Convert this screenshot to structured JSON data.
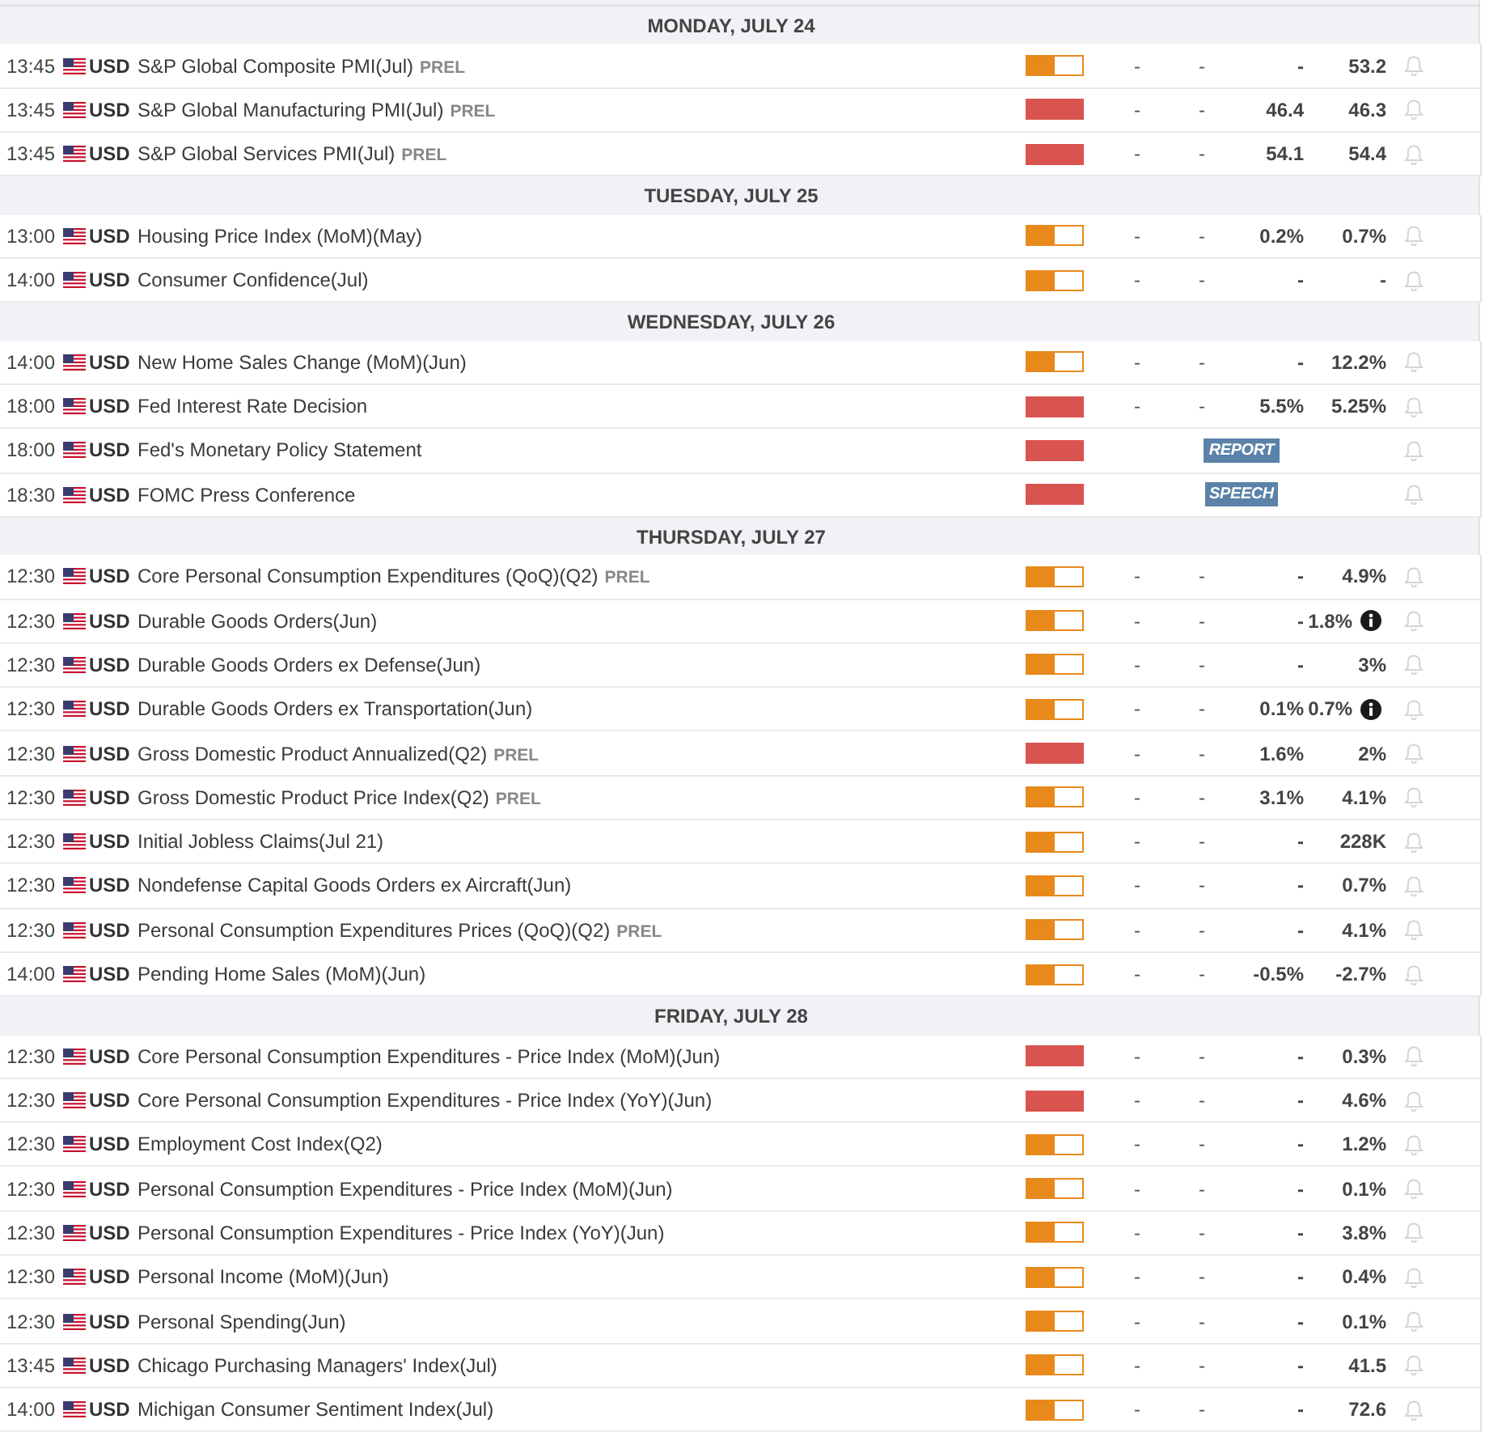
{
  "days": [
    {
      "label": "MONDAY, JULY 24",
      "events": [
        {
          "time": "13:45",
          "currency": "USD",
          "title": "S&P Global Composite PMI(Jul)",
          "note": "PREL",
          "level": 0.5,
          "values": [
            "-",
            "-",
            "-",
            "53.2"
          ],
          "info": false
        },
        {
          "time": "13:45",
          "currency": "USD",
          "title": "S&P Global Manufacturing PMI(Jul)",
          "note": "PREL",
          "level": 1,
          "values": [
            "-",
            "-",
            "46.4",
            "46.3"
          ],
          "info": false
        },
        {
          "time": "13:45",
          "currency": "USD",
          "title": "S&P Global Services PMI(Jul)",
          "note": "PREL",
          "level": 1,
          "values": [
            "-",
            "-",
            "54.1",
            "54.4"
          ],
          "info": false
        }
      ]
    },
    {
      "label": "TUESDAY, JULY 25",
      "events": [
        {
          "time": "13:00",
          "currency": "USD",
          "title": "Housing Price Index (MoM)(May)",
          "level": 0.5,
          "values": [
            "-",
            "-",
            "0.2%",
            "0.7%"
          ],
          "info": false
        },
        {
          "time": "14:00",
          "currency": "USD",
          "title": "Consumer Confidence(Jul)",
          "level": 0.5,
          "values": [
            "-",
            "-",
            "-",
            "-"
          ],
          "info": false
        }
      ]
    },
    {
      "label": "WEDNESDAY, JULY 26",
      "events": [
        {
          "time": "14:00",
          "currency": "USD",
          "title": "New Home Sales Change (MoM)(Jun)",
          "level": 0.5,
          "values": [
            "-",
            "-",
            "-",
            "12.2%"
          ],
          "info": false
        },
        {
          "time": "18:00",
          "currency": "USD",
          "title": "Fed Interest Rate Decision",
          "level": 1,
          "values": [
            "-",
            "-",
            "5.5%",
            "5.25%"
          ],
          "info": false
        },
        {
          "time": "18:00",
          "currency": "USD",
          "title": "Fed's Monetary Policy Statement",
          "level": 1,
          "tag": "REPORT",
          "info": false
        },
        {
          "time": "18:30",
          "currency": "USD",
          "title": "FOMC Press Conference",
          "level": 1,
          "tag": "SPEECH",
          "info": false
        }
      ]
    },
    {
      "label": "THURSDAY, JULY 27",
      "events": [
        {
          "time": "12:30",
          "currency": "USD",
          "title": "Core Personal Consumption Expenditures (QoQ)(Q2)",
          "note": "PREL",
          "level": 0.5,
          "values": [
            "-",
            "-",
            "-",
            "4.9%"
          ],
          "info": false
        },
        {
          "time": "12:30",
          "currency": "USD",
          "title": "Durable Goods Orders(Jun)",
          "level": 0.5,
          "values": [
            "-",
            "-",
            "-",
            "1.8%"
          ],
          "info": true
        },
        {
          "time": "12:30",
          "currency": "USD",
          "title": "Durable Goods Orders ex Defense(Jun)",
          "level": 0.5,
          "values": [
            "-",
            "-",
            "-",
            "3%"
          ],
          "info": false
        },
        {
          "time": "12:30",
          "currency": "USD",
          "title": "Durable Goods Orders ex Transportation(Jun)",
          "level": 0.5,
          "values": [
            "-",
            "-",
            "0.1%",
            "0.7%"
          ],
          "info": true
        },
        {
          "time": "12:30",
          "currency": "USD",
          "title": "Gross Domestic Product Annualized(Q2)",
          "note": "PREL",
          "level": 1,
          "values": [
            "-",
            "-",
            "1.6%",
            "2%"
          ],
          "info": false
        },
        {
          "time": "12:30",
          "currency": "USD",
          "title": "Gross Domestic Product Price Index(Q2)",
          "note": "PREL",
          "level": 0.5,
          "values": [
            "-",
            "-",
            "3.1%",
            "4.1%"
          ],
          "info": false
        },
        {
          "time": "12:30",
          "currency": "USD",
          "title": "Initial Jobless Claims(Jul 21)",
          "level": 0.5,
          "values": [
            "-",
            "-",
            "-",
            "228K"
          ],
          "info": false
        },
        {
          "time": "12:30",
          "currency": "USD",
          "title": "Nondefense Capital Goods Orders ex Aircraft(Jun)",
          "level": 0.5,
          "values": [
            "-",
            "-",
            "-",
            "0.7%"
          ],
          "info": false
        },
        {
          "time": "12:30",
          "currency": "USD",
          "title": "Personal Consumption Expenditures Prices (QoQ)(Q2)",
          "note": "PREL",
          "level": 0.5,
          "values": [
            "-",
            "-",
            "-",
            "4.1%"
          ],
          "info": false
        },
        {
          "time": "14:00",
          "currency": "USD",
          "title": "Pending Home Sales (MoM)(Jun)",
          "level": 0.5,
          "values": [
            "-",
            "-",
            "-0.5%",
            "-2.7%"
          ],
          "info": false
        }
      ]
    },
    {
      "label": "FRIDAY, JULY 28",
      "events": [
        {
          "time": "12:30",
          "currency": "USD",
          "title": "Core Personal Consumption Expenditures - Price Index (MoM)(Jun)",
          "level": 1,
          "values": [
            "-",
            "-",
            "-",
            "0.3%"
          ],
          "info": false
        },
        {
          "time": "12:30",
          "currency": "USD",
          "title": "Core Personal Consumption Expenditures - Price Index (YoY)(Jun)",
          "level": 1,
          "values": [
            "-",
            "-",
            "-",
            "4.6%"
          ],
          "info": false
        },
        {
          "time": "12:30",
          "currency": "USD",
          "title": "Employment Cost Index(Q2)",
          "level": 0.5,
          "values": [
            "-",
            "-",
            "-",
            "1.2%"
          ],
          "info": false
        },
        {
          "time": "12:30",
          "currency": "USD",
          "title": "Personal Consumption Expenditures - Price Index (MoM)(Jun)",
          "level": 0.5,
          "values": [
            "-",
            "-",
            "-",
            "0.1%"
          ],
          "info": false
        },
        {
          "time": "12:30",
          "currency": "USD",
          "title": "Personal Consumption Expenditures - Price Index (YoY)(Jun)",
          "level": 0.5,
          "values": [
            "-",
            "-",
            "-",
            "3.8%"
          ],
          "info": false
        },
        {
          "time": "12:30",
          "currency": "USD",
          "title": "Personal Income (MoM)(Jun)",
          "level": 0.5,
          "values": [
            "-",
            "-",
            "-",
            "0.4%"
          ],
          "info": false
        },
        {
          "time": "12:30",
          "currency": "USD",
          "title": "Personal Spending(Jun)",
          "level": 0.5,
          "values": [
            "-",
            "-",
            "-",
            "0.1%"
          ],
          "info": false
        },
        {
          "time": "13:45",
          "currency": "USD",
          "title": "Chicago Purchasing Managers' Index(Jul)",
          "level": 0.5,
          "values": [
            "-",
            "-",
            "-",
            "41.5"
          ],
          "info": false
        },
        {
          "time": "14:00",
          "currency": "USD",
          "title": "Michigan Consumer Sentiment Index(Jul)",
          "level": 0.5,
          "values": [
            "-",
            "-",
            "-",
            "72.6"
          ],
          "info": false
        }
      ]
    }
  ]
}
